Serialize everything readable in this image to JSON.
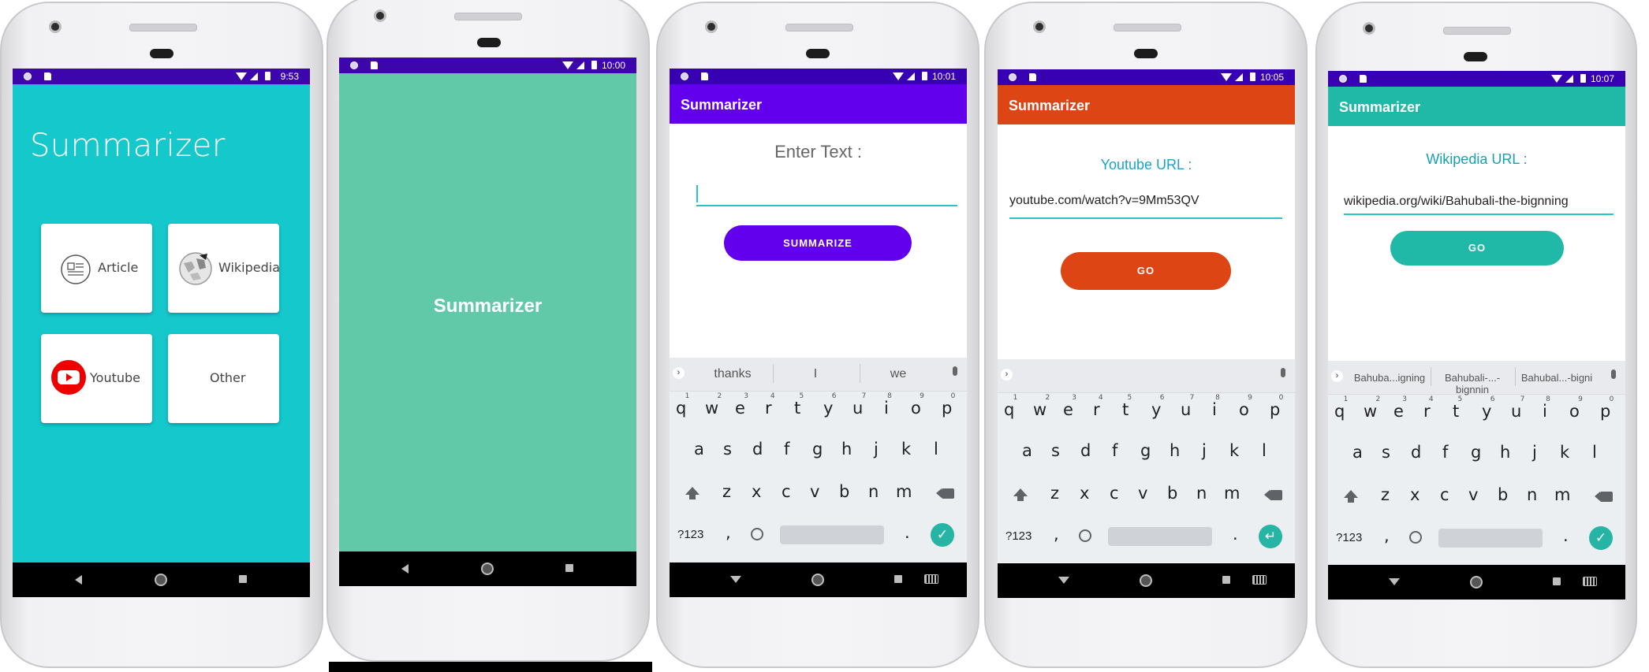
{
  "screens": [
    {
      "time": "9:53",
      "title": "Summarizer",
      "cards": [
        "Article",
        "Wikipedia",
        "Youtube",
        "Other"
      ],
      "colors": {
        "bg": "#14c8cc",
        "status": "#3d06ad"
      }
    },
    {
      "time": "10:00",
      "title": "Summarizer",
      "colors": {
        "bg": "#61c8a8",
        "status": "#3d06ad"
      }
    },
    {
      "time": "10:01",
      "title": "Summarizer",
      "prompt": "Enter Text :",
      "input_value": "",
      "button": "SUMMARIZE",
      "suggestions": [
        "thanks",
        "I",
        "we"
      ],
      "colors": {
        "appbar": "#6200ee",
        "status": "#3700b3",
        "button": "#6200ee",
        "underline": "#26c6c6"
      }
    },
    {
      "time": "10:05",
      "title": "Summarizer",
      "prompt": "Youtube URL :",
      "input_value": "youtube.com/watch?v=9Mm53QV",
      "button": "GO",
      "suggestions": [],
      "colors": {
        "appbar": "#dd4514",
        "status": "#3700b3",
        "button": "#dd4514",
        "prompt": "#1aa3c9"
      }
    },
    {
      "time": "10:07",
      "title": "Summarizer",
      "prompt": "Wikipedia URL :",
      "input_value": "wikipedia.org/wiki/Bahubali-the-bignning",
      "button": "GO",
      "suggestions": [
        "Bahuba...igning",
        "Bahubali-...-bignnin",
        "Bahubal...-bigni"
      ],
      "colors": {
        "appbar": "#20b8a6",
        "status": "#3700b3",
        "button": "#20b8a6",
        "prompt": "#13a3b0"
      }
    }
  ],
  "keyboard": {
    "row1": [
      "q",
      "w",
      "e",
      "r",
      "t",
      "y",
      "u",
      "i",
      "o",
      "p"
    ],
    "row1_hints": [
      "1",
      "2",
      "3",
      "4",
      "5",
      "6",
      "7",
      "8",
      "9",
      "0"
    ],
    "row2": [
      "a",
      "s",
      "d",
      "f",
      "g",
      "h",
      "j",
      "k",
      "l"
    ],
    "row3": [
      "z",
      "x",
      "c",
      "v",
      "b",
      "n",
      "m"
    ],
    "sym_key": "?123",
    "comma": ",",
    "period": ".",
    "icons": [
      "shift-icon",
      "backspace-icon",
      "emoji-icon",
      "enter-icon",
      "mic-icon"
    ]
  }
}
